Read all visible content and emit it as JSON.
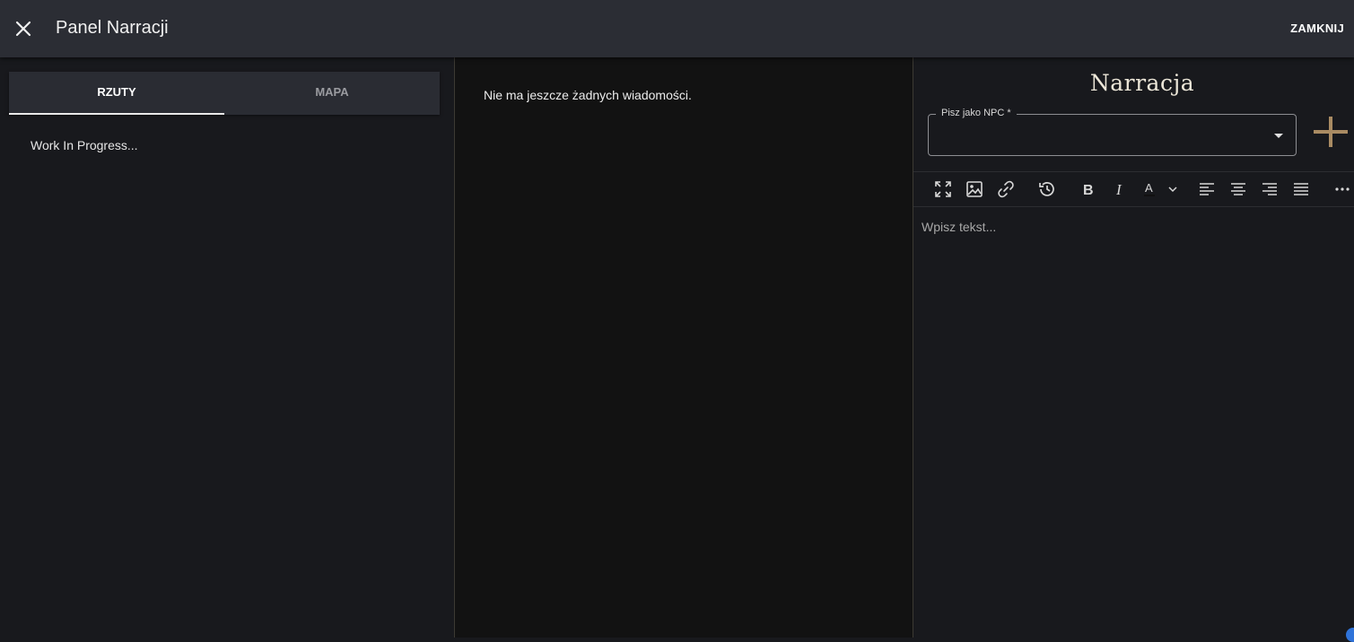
{
  "header": {
    "title": "Panel Narracji",
    "close_label": "ZAMKNIJ"
  },
  "left_panel": {
    "tabs": [
      {
        "label": "RZUTY",
        "active": true
      },
      {
        "label": "MAPA",
        "active": false
      }
    ],
    "content_text": "Work In Progress..."
  },
  "middle_panel": {
    "empty_text": "Nie ma jeszcze żadnych wiadomości."
  },
  "right_panel": {
    "heading": "Narracja",
    "npc_select": {
      "label": "Pisz jako NPC *",
      "value": ""
    },
    "editor": {
      "placeholder": "Wpisz tekst..."
    },
    "toolbar_icons": [
      "fullscreen-icon",
      "image-icon",
      "link-icon",
      "history-icon",
      "bold-icon",
      "italic-icon",
      "font-color-icon",
      "align-left-icon",
      "align-center-icon",
      "align-right-icon",
      "align-justify-icon",
      "more-icon"
    ]
  },
  "colors": {
    "accent_plus": "#a98b63",
    "topbar": "#2b2d34",
    "panel_dark": "#121212"
  }
}
